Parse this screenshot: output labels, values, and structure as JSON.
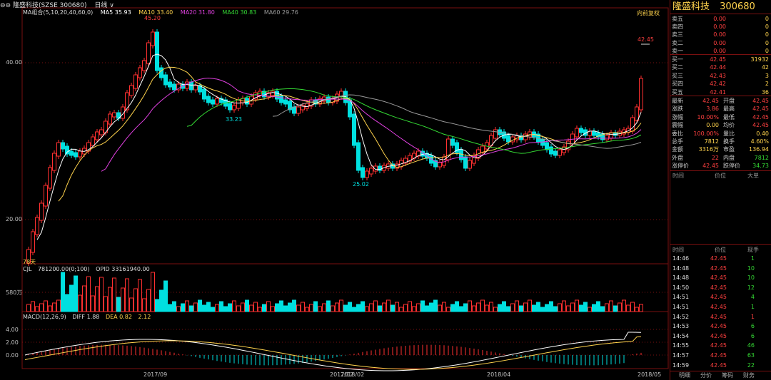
{
  "header": {
    "menu_icon": "menu-icon",
    "symbol_label": "隆盛科技(SZSE 300680)",
    "period_label": "日线",
    "restore_label": "向前复权"
  },
  "ma_legend": {
    "group_label": "MA组合(5,10,20,40,60,0)",
    "items": [
      {
        "label": "MA5 35.93",
        "color": "#ffffff"
      },
      {
        "label": "MA10 33.40",
        "color": "#ffd34d"
      },
      {
        "label": "MA20 31.80",
        "color": "#e040e0"
      },
      {
        "label": "MA40 30.83",
        "color": "#34d934"
      },
      {
        "label": "MA60 29.76",
        "color": "#9a9a9a"
      }
    ]
  },
  "price_axis": [
    "40.00",
    "20.00"
  ],
  "annotations": {
    "high": "45.20",
    "mid": "33.23",
    "low": "25.02",
    "last": "42.45"
  },
  "days_label": "78天",
  "volume_panel": {
    "label": "CJL",
    "value": "781200.00(0;100)",
    "opid": "OPID 33161940.00",
    "axis": "580万"
  },
  "macd_panel": {
    "label": "MACD(12,26,9)",
    "diff": "DIFF 1.88",
    "dea": "DEA 0.82",
    "macd": "2.12",
    "axis": [
      "4.00",
      "2.00",
      "0.00"
    ]
  },
  "date_axis": [
    "2017/09",
    "2017/12",
    "2018/02",
    "2018/04",
    "2018/05"
  ],
  "quote": {
    "name": "隆盛科技",
    "code": "300680",
    "asks": [
      {
        "label": "卖五",
        "price": "0.00",
        "vol": "0"
      },
      {
        "label": "卖四",
        "price": "0.00",
        "vol": "0"
      },
      {
        "label": "卖三",
        "price": "0.00",
        "vol": "0"
      },
      {
        "label": "卖二",
        "price": "0.00",
        "vol": "0"
      },
      {
        "label": "卖一",
        "price": "0.00",
        "vol": "0"
      }
    ],
    "bids": [
      {
        "label": "买一",
        "price": "42.45",
        "vol": "31932"
      },
      {
        "label": "买二",
        "price": "42.44",
        "vol": "42"
      },
      {
        "label": "买三",
        "price": "42.43",
        "vol": "3"
      },
      {
        "label": "买四",
        "price": "42.42",
        "vol": "2"
      },
      {
        "label": "买五",
        "price": "42.41",
        "vol": "36"
      }
    ],
    "stats": [
      {
        "l1": "最新",
        "v1": "42.45",
        "c1": "red",
        "l2": "开盘",
        "v2": "42.45",
        "c2": "red"
      },
      {
        "l1": "涨跌",
        "v1": "3.86",
        "c1": "red",
        "l2": "最高",
        "v2": "42.45",
        "c2": "red"
      },
      {
        "l1": "涨幅",
        "v1": "10.00%",
        "c1": "red",
        "l2": "最低",
        "v2": "42.45",
        "c2": "red"
      },
      {
        "l1": "震幅",
        "v1": "0.00",
        "c1": "yellow",
        "l2": "均价",
        "v2": "42.45",
        "c2": "red"
      },
      {
        "l1": "委比",
        "v1": "100.00%",
        "c1": "red",
        "l2": "量比",
        "v2": "0.40",
        "c2": "yellow"
      },
      {
        "l1": "总手",
        "v1": "7812",
        "c1": "yellow",
        "l2": "换手",
        "v2": "4.60%",
        "c2": "yellow"
      },
      {
        "l1": "金额",
        "v1": "3316万",
        "c1": "yellow",
        "l2": "市盈",
        "v2": "136.94",
        "c2": "yellow"
      },
      {
        "l1": "外盘",
        "v1": "22",
        "c1": "red",
        "l2": "内盘",
        "v2": "7812",
        "c2": "green"
      },
      {
        "l1": "涨停价",
        "v1": "42.45",
        "c1": "red",
        "l2": "跌停价",
        "v2": "34.73",
        "c2": "green"
      }
    ],
    "big_header": {
      "time": "时间",
      "price": "价位",
      "big": "大单"
    },
    "trades_header": {
      "time": "时间",
      "price": "价位",
      "vol": "现手"
    },
    "trades": [
      {
        "time": "14:46",
        "price": "42.45",
        "vol": "1",
        "c": "green"
      },
      {
        "time": "14:48",
        "price": "42.45",
        "vol": "10",
        "c": "green"
      },
      {
        "time": "14:48",
        "price": "42.45",
        "vol": "10",
        "c": "green"
      },
      {
        "time": "14:50",
        "price": "42.45",
        "vol": "12",
        "c": "green"
      },
      {
        "time": "14:51",
        "price": "42.45",
        "vol": "4",
        "c": "green"
      },
      {
        "time": "14:51",
        "price": "42.45",
        "vol": "1",
        "c": "green"
      },
      {
        "time": "14:52",
        "price": "42.45",
        "vol": "1",
        "c": "red"
      },
      {
        "time": "14:53",
        "price": "42.45",
        "vol": "6",
        "c": "green"
      },
      {
        "time": "14:54",
        "price": "42.45",
        "vol": "6",
        "c": "green"
      },
      {
        "time": "14:55",
        "price": "42.45",
        "vol": "46",
        "c": "green"
      },
      {
        "time": "14:57",
        "price": "42.45",
        "vol": "63",
        "c": "green"
      },
      {
        "time": "14:59",
        "price": "42.45",
        "vol": "22",
        "c": "green"
      }
    ],
    "tabs": [
      "明细",
      "分价",
      "筹码",
      "财务"
    ]
  },
  "colors": {
    "up": "#ff3030",
    "down": "#00e0e0",
    "grid": "#7a1010",
    "ma5": "#ffffff",
    "ma10": "#ffd34d",
    "ma20": "#e040e0",
    "ma40": "#34d934",
    "ma60": "#9a9a9a"
  }
}
